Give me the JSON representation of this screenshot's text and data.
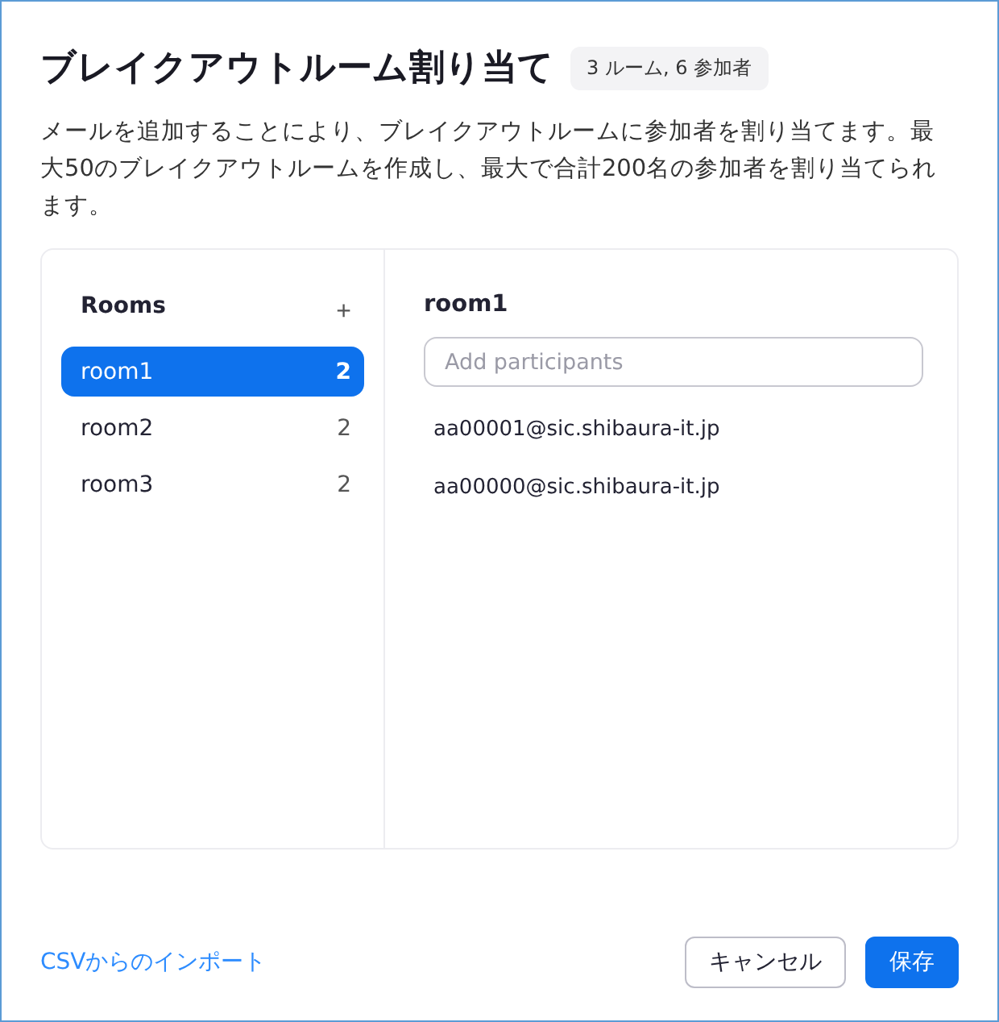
{
  "dialog": {
    "title": "ブレイクアウトルーム割り当て",
    "summary_badge": "3 ルーム, 6 参加者",
    "description": "メールを追加することにより、ブレイクアウトルームに参加者を割り当てます。最大50のブレイクアウトルームを作成し、最大で合計200名の参加者を割り当てられます。"
  },
  "rooms_panel": {
    "heading": "Rooms",
    "add_button": "+",
    "rooms": [
      {
        "name": "room1",
        "count": "2",
        "selected": true
      },
      {
        "name": "room2",
        "count": "2",
        "selected": false
      },
      {
        "name": "room3",
        "count": "2",
        "selected": false
      }
    ]
  },
  "room_detail": {
    "heading": "room1",
    "search": {
      "placeholder": "Add participants"
    },
    "participants": [
      "aa00001@sic.shibaura-it.jp",
      "aa00000@sic.shibaura-it.jp"
    ]
  },
  "footer": {
    "import_link": "CSVからのインポート",
    "buttons": [
      {
        "label": "キャンセル",
        "kind": "secondary"
      },
      {
        "label": "保存",
        "kind": "primary"
      }
    ]
  }
}
